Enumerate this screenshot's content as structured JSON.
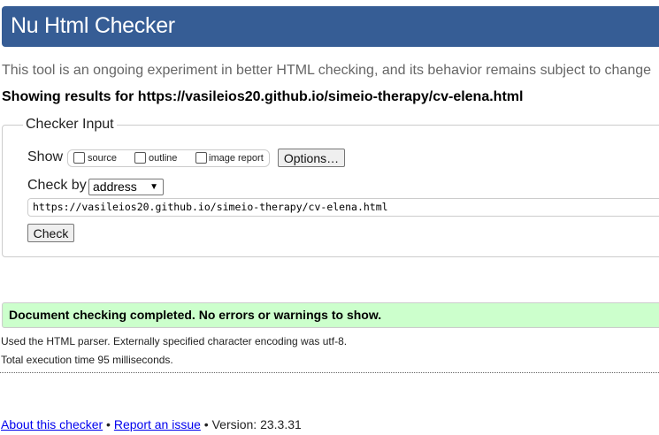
{
  "header": {
    "title": "Nu Html Checker"
  },
  "tagline": "This tool is an ongoing experiment in better HTML checking, and its behavior remains subject to change",
  "showing": "Showing results for https://vasileios20.github.io/simeio-therapy/cv-elena.html",
  "checker": {
    "legend": "Checker Input",
    "show_label": "Show",
    "options": [
      {
        "label": "source",
        "checked": false
      },
      {
        "label": "outline",
        "checked": false
      },
      {
        "label": "image report",
        "checked": false
      }
    ],
    "options_button": "Options…",
    "check_by_label": "Check by",
    "check_by_value": "address",
    "url_value": "https://vasileios20.github.io/simeio-therapy/cv-elena.html",
    "check_button": "Check"
  },
  "results": {
    "success": "Document checking completed. No errors or warnings to show.",
    "parser_note": "Used the HTML parser. Externally specified character encoding was utf-8.",
    "time_note": "Total execution time 95 milliseconds."
  },
  "footer": {
    "about": "About this checker",
    "sep1": " • ",
    "report": "Report an issue",
    "sep2": " • ",
    "version": "Version: 23.3.31"
  }
}
